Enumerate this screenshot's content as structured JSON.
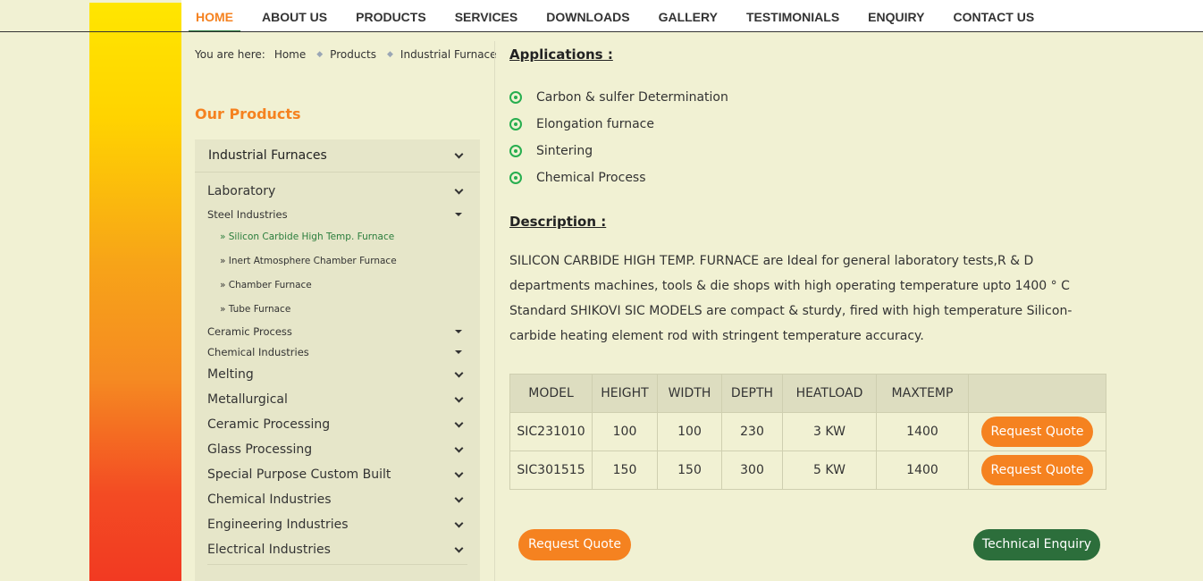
{
  "nav": {
    "items": [
      {
        "label": "HOME",
        "active": true
      },
      {
        "label": "ABOUT US"
      },
      {
        "label": "PRODUCTS"
      },
      {
        "label": "SERVICES"
      },
      {
        "label": "DOWNLOADS"
      },
      {
        "label": "GALLERY"
      },
      {
        "label": "TESTIMONIALS"
      },
      {
        "label": "ENQUIRY"
      },
      {
        "label": "CONTACT US"
      }
    ]
  },
  "breadcrumb": {
    "lead": "You are here:",
    "items": [
      "Home",
      "Products",
      "Industrial Furnace"
    ]
  },
  "sidebar": {
    "heading": "Our Products",
    "top_category": "Industrial Furnaces",
    "items": [
      {
        "label": "Laboratory",
        "level": "big"
      },
      {
        "label": "Steel Industries",
        "level": "small"
      },
      {
        "label": "» Silicon Carbide High Temp. Furnace",
        "level": "leaf",
        "active": true
      },
      {
        "label": "» Inert Atmosphere Chamber Furnace",
        "level": "leaf"
      },
      {
        "label": "» Chamber Furnace",
        "level": "leaf"
      },
      {
        "label": "» Tube Furnace",
        "level": "leaf"
      },
      {
        "label": "Ceramic Process",
        "level": "small"
      },
      {
        "label": "Chemical Industries",
        "level": "small"
      },
      {
        "label": "Melting",
        "level": "big"
      },
      {
        "label": "Metallurgical",
        "level": "big"
      },
      {
        "label": "Ceramic Processing",
        "level": "big"
      },
      {
        "label": "Glass Processing",
        "level": "big"
      },
      {
        "label": "Special Purpose Custom Built",
        "level": "big"
      },
      {
        "label": "Chemical Industries",
        "level": "big"
      },
      {
        "label": "Engineering Industries",
        "level": "big"
      },
      {
        "label": "Electrical Industries",
        "level": "big"
      }
    ]
  },
  "applications": {
    "title": "Applications :",
    "items": [
      "Carbon & sulfer Determination",
      "Elongation furnace",
      "Sintering",
      "Chemical Process"
    ]
  },
  "description": {
    "title": "Description :",
    "text": "SILICON CARBIDE HIGH TEMP. FURNACE are Ideal for general laboratory tests,R & D departments machines, tools & die shops with high operating temperature upto 1400 ° C Standard SHIKOVI SIC MODELS are compact & sturdy, fired with high temperature Silicon-carbide heating element rod with stringent temperature accuracy."
  },
  "table": {
    "headers": [
      "MODEL",
      "HEIGHT",
      "WIDTH",
      "DEPTH",
      "HEATLOAD",
      "MAXTEMP",
      ""
    ],
    "rows": [
      [
        "SIC231010",
        "100",
        "100",
        "230",
        "3 KW",
        "1400"
      ],
      [
        "SIC301515",
        "150",
        "150",
        "300",
        "5 KW",
        "1400"
      ]
    ],
    "row_button_label": "Request Quote"
  },
  "actions": {
    "request_quote": "Request Quote",
    "technical_enquiry": "Technical Enquiry"
  },
  "colors": {
    "accent_orange": "#f58220",
    "accent_green": "#2c6e3b",
    "bullet_green": "#27ae4f",
    "page_bg": "#f1f1d3"
  }
}
